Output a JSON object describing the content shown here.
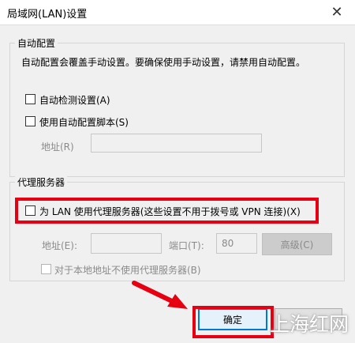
{
  "window": {
    "title": "局域网(LAN)设置",
    "close_icon": "close-icon"
  },
  "auto_config": {
    "legend": "自动配置",
    "description": "自动配置会覆盖手动设置。要确保使用手动设置，请禁用自动配置。",
    "auto_detect_label": "自动检测设置(A)",
    "use_script_label": "使用自动配置脚本(S)",
    "address_label": "地址(R)",
    "address_value": ""
  },
  "proxy": {
    "legend": "代理服务器",
    "use_proxy_label": "为 LAN 使用代理服务器(这些设置不用于拨号或 VPN 连接)(X)",
    "address_label": "地址(E):",
    "address_value": "",
    "port_label": "端口(T):",
    "port_value": "80",
    "advanced_label": "高级(C)",
    "bypass_local_label": "对于本地地址不使用代理服务器(B)"
  },
  "buttons": {
    "ok_label": "确定"
  },
  "watermark": "上海红网",
  "colors": {
    "highlight": "#e60012",
    "arrow": "#e60012",
    "focus": "#0078d7"
  }
}
